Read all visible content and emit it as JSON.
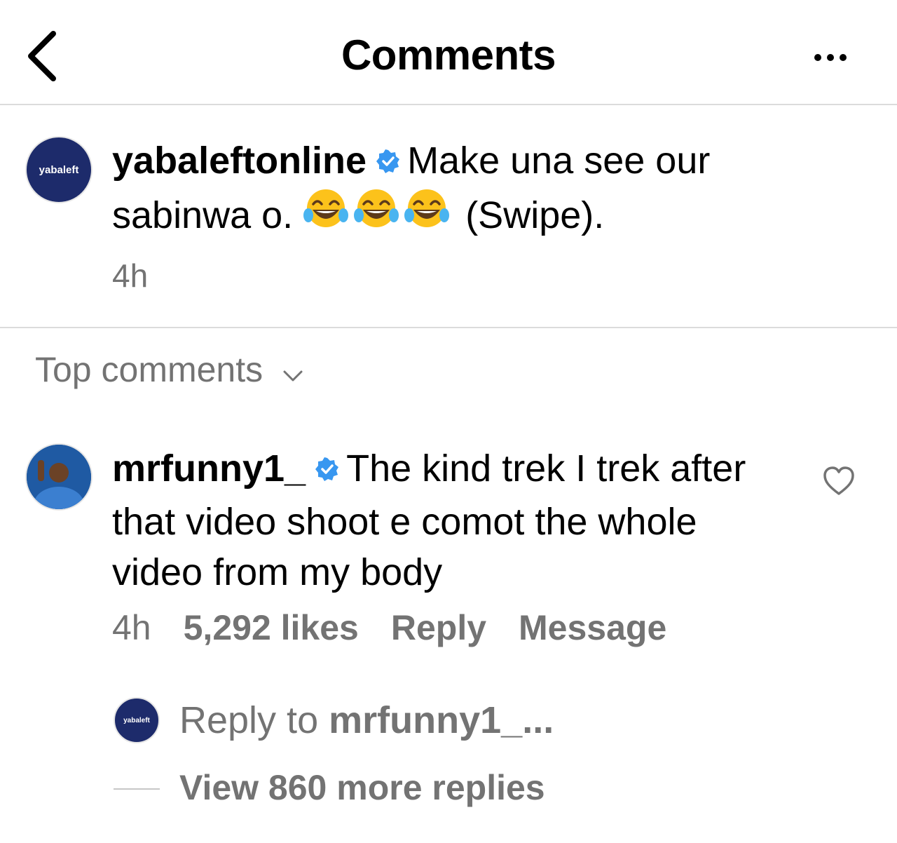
{
  "header": {
    "title": "Comments"
  },
  "post": {
    "avatar_text": "yabaleft",
    "username": "yabaleftonline",
    "caption_part1": "Make una see our sabinwa o.",
    "caption_part2": "(Swipe).",
    "time": "4h"
  },
  "sort": {
    "label": "Top comments"
  },
  "comment": {
    "username": "mrfunny1_",
    "text": "The kind trek I trek after that video shoot e comot the whole video from my body",
    "time": "4h",
    "likes": "5,292 likes",
    "reply_label": "Reply",
    "message_label": "Message"
  },
  "reply_prompt": {
    "avatar_text": "yabaleft",
    "prefix": "Reply to",
    "username": "mrfunny1_...",
    "view_more": "View 860 more replies"
  },
  "colors": {
    "verified": "#3897f0",
    "secondary_text": "#737373",
    "brand": "#1d2b6b"
  }
}
